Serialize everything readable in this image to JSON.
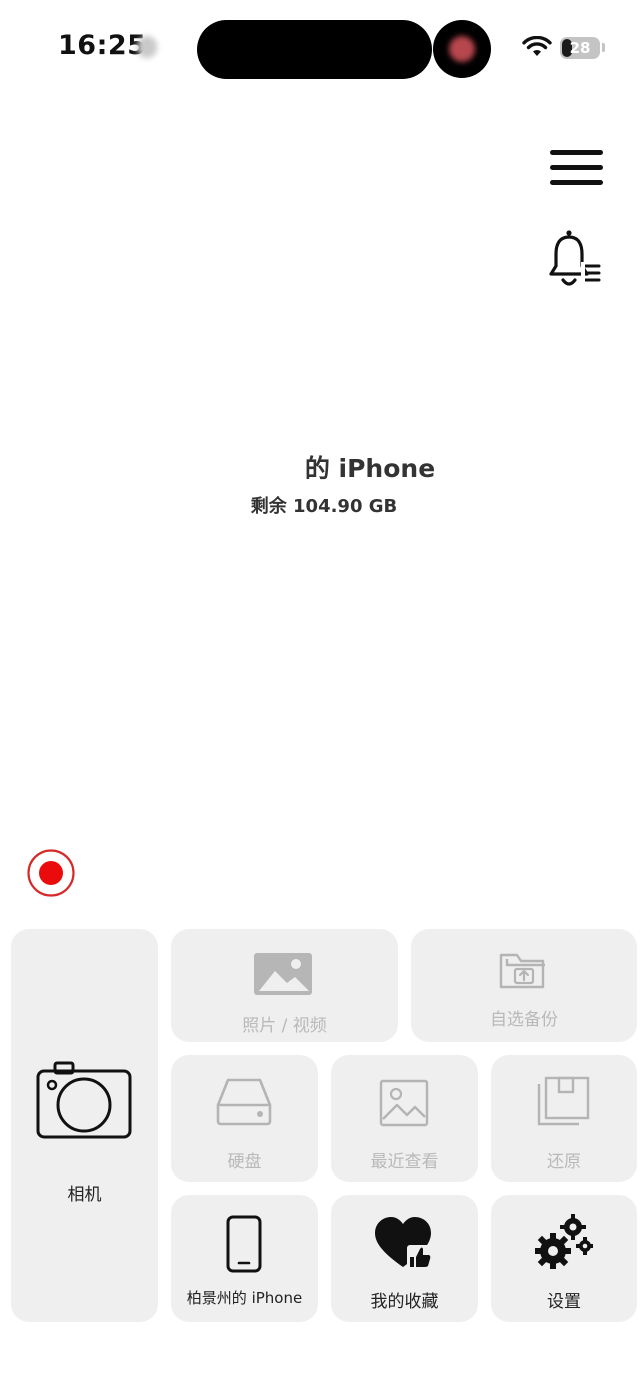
{
  "status_bar": {
    "time": "16:25",
    "battery": "28"
  },
  "device": {
    "name": "的 iPhone",
    "storage_text": "剩余 104.90 GB"
  },
  "tiles": {
    "camera": "相机",
    "photos_videos": "照片 / 视频",
    "custom_backup": "自选备份",
    "hard_disk": "硬盘",
    "recently_viewed": "最近查看",
    "restore": "还原",
    "my_iphone": "柏景州的 iPhone",
    "favorites": "我的收藏",
    "settings": "设置"
  },
  "colors": {
    "record": "#e01b1b",
    "disabled_text": "#b9b9b9",
    "tile_bg": "#efefef"
  }
}
